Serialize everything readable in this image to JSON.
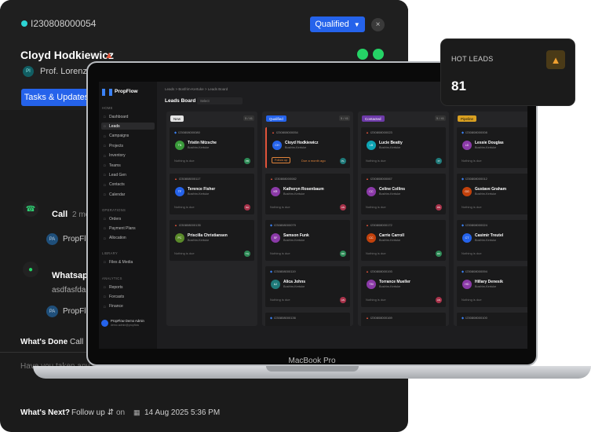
{
  "lead_panel": {
    "lead_id": "I230808000054",
    "status": "Qualified",
    "close_glyph": "×",
    "name": "Cloyd Hodkiewicz",
    "agent_initials": "PI",
    "agent_name": "Prof. Lorenz Ro",
    "tasks_tab": "Tasks & Updates",
    "activities": [
      {
        "title": "Call",
        "sub": "2 mo",
        "user_initials": "PA",
        "user": "PropFlo"
      },
      {
        "title": "Whatsapp",
        "message": "asdfasfdas",
        "user_initials": "PA",
        "user": "PropFlo"
      }
    ],
    "whats_done_label": "What's Done",
    "whats_done_value": "Call",
    "note_placeholder": "Have you taken any st",
    "whats_next_label": "What's Next?",
    "whats_next_value": "Follow up",
    "on_label": "on",
    "next_date": "14 Aug 2025 5:36 PM",
    "colors": {
      "status_blue": "#2563eb",
      "whatsapp_green": "#25d366",
      "hot_flame": "#e0533a"
    }
  },
  "laptop": {
    "label": "MacBook Pro",
    "app": {
      "brand": "PropFlow",
      "sidebar": {
        "groups": [
          {
            "label": "HOME",
            "items": [
              "Dashboard",
              "Leads",
              "Campaigns",
              "Projects",
              "Inventory",
              "Teams",
              "Lead Gen",
              "Contacts",
              "Calendar"
            ]
          },
          {
            "label": "OPERATIONS",
            "items": [
              "Orders",
              "Payment Plans",
              "Allocation"
            ]
          },
          {
            "label": "LIBRARY",
            "items": [
              "Files & Media"
            ]
          },
          {
            "label": "ANALYTICS",
            "items": [
              "Reports",
              "Forcasts",
              "Finance"
            ]
          }
        ],
        "active": "Leads",
        "user_name": "PropFlow Demo Admin",
        "user_email": "demo.admin@propflow"
      },
      "breadcrumbs": "Leads  >  Bosfrim-Kertuke  >  Leads Board",
      "board_title": "Leads Board",
      "filter_placeholder": "Select",
      "columns": [
        {
          "label": "New",
          "count": "5 / 41",
          "color": "#e5e5e5",
          "text_color": "#111111",
          "cards": [
            {
              "id": "I230808000080",
              "name": "Tristin Nitzsche",
              "loc": "Bosfrim-Kertuke",
              "initials": "TN",
              "av": "#3a9b3a",
              "due": "Nothing is due",
              "chip": "PB",
              "chip_color": "#2e8b57"
            },
            {
              "id": "I230808000117",
              "name": "Terence Fisher",
              "loc": "Bosfrim-Kertuke",
              "initials": "TF",
              "av": "#2563eb",
              "due": "Nothing is due",
              "chip": "SA",
              "chip_color": "#a8324a"
            },
            {
              "id": "I230808000135",
              "name": "Priscilla Christiansen",
              "loc": "Bosfrim-Kertuke",
              "initials": "PC",
              "av": "#5a8a2a",
              "due": "Nothing is due",
              "chip": "TG",
              "chip_color": "#2e8b57"
            }
          ]
        },
        {
          "label": "Qualified",
          "count": "5 / 41",
          "color": "#2563eb",
          "text_color": "#ffffff",
          "cards": [
            {
              "id": "I230808000054",
              "name": "Cloyd Hodkiewicz",
              "loc": "Bosfrim-Kertuke",
              "initials": "CH",
              "av": "#2563eb",
              "follow": "Follow up",
              "ago": "Due a month ago",
              "chip": "PL",
              "chip_color": "#1f7a7a",
              "highlight": true
            },
            {
              "id": "I230808000082",
              "name": "Katheryn Rosenbaum",
              "loc": "Bosfrim-Kertuke",
              "initials": "KR",
              "av": "#8b3aa8",
              "due": "Nothing is due",
              "chip": "AN",
              "chip_color": "#a8324a"
            },
            {
              "id": "I230808000079",
              "name": "Samson Funk",
              "loc": "Bosfrim-Kertuke",
              "initials": "SF",
              "av": "#8b3aa8",
              "due": "Nothing is due",
              "chip": "RD",
              "chip_color": "#2e8b57"
            },
            {
              "id": "I230808000119",
              "name": "Alica Johns",
              "loc": "Bosfrim-Kertuke",
              "initials": "AJ",
              "av": "#1f7a7a",
              "due": "Nothing is due",
              "chip": "AN",
              "chip_color": "#a8324a"
            },
            {
              "id": "I230808000136"
            }
          ]
        },
        {
          "label": "Contacted",
          "count": "5 / 41",
          "color": "#6d3aa8",
          "text_color": "#ffffff",
          "cards": [
            {
              "id": "I230808000023",
              "name": "Lucie Beatty",
              "loc": "Bosfrim-Kertuke",
              "initials": "LB",
              "av": "#0ea5b4",
              "due": "Nothing is due",
              "chip": "PI",
              "chip_color": "#1f7a7a"
            },
            {
              "id": "I230808000067",
              "name": "Celine Collins",
              "loc": "Bosfrim-Kertuke",
              "initials": "CC",
              "av": "#8b3aa8",
              "due": "Nothing is due",
              "chip": "RN",
              "chip_color": "#a8324a"
            },
            {
              "id": "I230808000172",
              "name": "Carrie Carroll",
              "loc": "Bosfrim-Kertuke",
              "initials": "CC",
              "av": "#c2410c",
              "due": "Nothing is due",
              "chip": "RK",
              "chip_color": "#2e8b57"
            },
            {
              "id": "I230808000193",
              "name": "Torrance Mueller",
              "loc": "Bosfrim-Kertuke",
              "initials": "TM",
              "av": "#8b3aa8",
              "due": "Nothing is due",
              "chip": "AN",
              "chip_color": "#a8324a"
            },
            {
              "id": "I230808000169"
            }
          ]
        },
        {
          "label": "Pipeline",
          "count": "",
          "color": "#d9a021",
          "text_color": "#111111",
          "cards": [
            {
              "id": "I230808000008",
              "name": "Lessie Douglas",
              "loc": "Bosfrim-Kertuke",
              "initials": "LD",
              "av": "#8b3aa8",
              "due": "Nothing is due",
              "chip": "",
              "chip_color": "#1f7a7a"
            },
            {
              "id": "I230808000012",
              "name": "Gustave Graham",
              "loc": "Bosfrim-Kertuke",
              "initials": "GG",
              "av": "#c2410c",
              "due": "Nothing is due",
              "chip": "",
              "chip_color": "#a8324a"
            },
            {
              "id": "I230808000024",
              "name": "Casimir Treutel",
              "loc": "Bosfrim-Kertuke",
              "initials": "CT",
              "av": "#2563eb",
              "due": "Nothing is due",
              "chip": "",
              "chip_color": "#2e8b57"
            },
            {
              "id": "I230808000094",
              "name": "Hillary Denesik",
              "loc": "Bosfrim-Kertuke",
              "initials": "HD",
              "av": "#8b3aa8",
              "due": "Nothing is due",
              "chip": "",
              "chip_color": "#a8324a"
            },
            {
              "id": "I230808000100"
            }
          ]
        }
      ]
    }
  },
  "hot_leads": {
    "title": "HOT LEADS",
    "value": "81",
    "icon": "flame-icon"
  }
}
